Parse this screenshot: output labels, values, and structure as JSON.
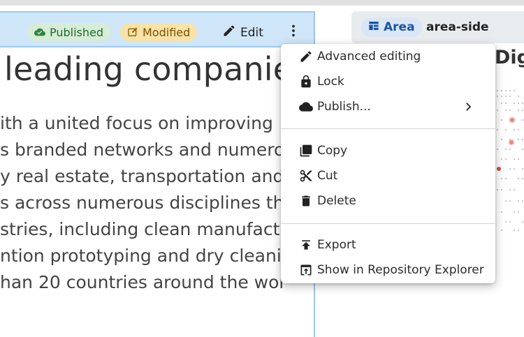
{
  "toolbar": {
    "published_label": "Published",
    "modified_label": "Modified",
    "edit_label": "Edit"
  },
  "content": {
    "heading": "leading companie",
    "lines": [
      "ith a united focus on improving",
      "s branded networks and numerou",
      "y real estate, transportation and",
      "s across numerous disciplines tha",
      "stries, including clean manufactur",
      "ntion prototyping and dry cleanin",
      "han 20 countries around the wor"
    ]
  },
  "right_area": {
    "badge_label": "Area",
    "name": "area-side",
    "heading_fragment": "Dig"
  },
  "menu": {
    "items": [
      {
        "label": "Advanced editing",
        "icon": "pencil-icon"
      },
      {
        "label": "Lock",
        "icon": "lock-icon"
      },
      {
        "label": "Publish...",
        "icon": "cloud-icon",
        "has_submenu": true
      },
      {
        "label": "Copy",
        "icon": "copy-icon"
      },
      {
        "label": "Cut",
        "icon": "scissors-icon"
      },
      {
        "label": "Delete",
        "icon": "trash-icon"
      },
      {
        "label": "Export",
        "icon": "export-icon"
      },
      {
        "label": "Show in Repository Explorer",
        "icon": "open-in-explorer-icon"
      }
    ]
  },
  "colors": {
    "accent_blue": "#9cc7f0",
    "toolbar_bg": "#cfe6f8",
    "published_bg": "#d6ecd6",
    "modified_bg": "#f9e2a8"
  }
}
